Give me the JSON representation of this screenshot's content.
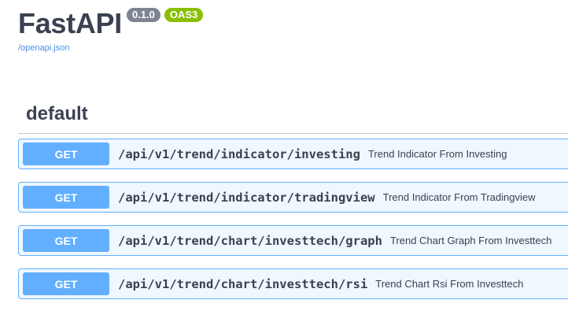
{
  "header": {
    "title": "FastAPI",
    "version_badge": "0.1.0",
    "oas_badge": "OAS3",
    "spec_link": "/openapi.json"
  },
  "section": {
    "title": "default"
  },
  "operations": [
    {
      "method": "GET",
      "path": "/api/v1/trend/indicator/investing",
      "summary": "Trend Indicator From Investing"
    },
    {
      "method": "GET",
      "path": "/api/v1/trend/indicator/tradingview",
      "summary": "Trend Indicator From Tradingview"
    },
    {
      "method": "GET",
      "path": "/api/v1/trend/chart/investtech/graph",
      "summary": "Trend Chart Graph From Investtech"
    },
    {
      "method": "GET",
      "path": "/api/v1/trend/chart/investtech/rsi",
      "summary": "Trend Chart Rsi From Investtech"
    }
  ],
  "colors": {
    "get_accent": "#61affe",
    "version_badge": "#7d8492",
    "oas_badge": "#89bf04",
    "link": "#4990e2",
    "text": "#3b4151"
  }
}
